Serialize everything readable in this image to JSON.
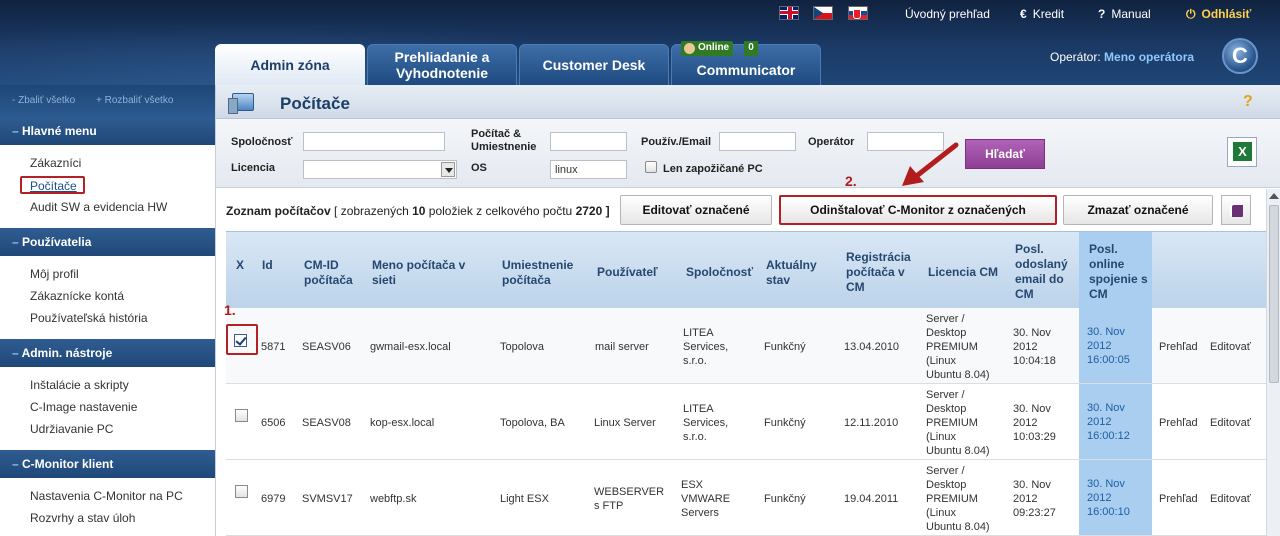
{
  "header": {
    "languages": [
      "en-flag-icon",
      "cz-flag-icon",
      "sk-flag-icon"
    ],
    "links": {
      "overview": "Úvodný prehľad",
      "credit": "Kredit",
      "manual": "Manual",
      "logout": "Odhlásiť"
    },
    "tabs": {
      "admin": "Admin zóna",
      "review": "Prehliadanie a Vyhodnotenie",
      "desk": "Customer Desk",
      "communicator": "Communicator"
    },
    "online_badge": "Online",
    "online_count": "0",
    "operator_label": "Operátor:",
    "operator_name": "Meno operátora",
    "logo_letter": "C"
  },
  "sidebar": {
    "collapse_all": "- Zbaliť všetko",
    "expand_all": "+ Rozbaliť všetko",
    "sections": [
      {
        "title": "Hlavné menu",
        "items": [
          "Zákazníci",
          "Počítače",
          "Audit SW a evidencia HW"
        ]
      },
      {
        "title": "Používatelia",
        "items": [
          "Môj profil",
          "Zákaznícke kontá",
          "Používateľská história"
        ]
      },
      {
        "title": "Admin. nástroje",
        "items": [
          "Inštalácie a skripty",
          "C-Image nastavenie",
          "Udržiavanie PC"
        ]
      },
      {
        "title": "C-Monitor klient",
        "items": [
          "Nastavenia C-Monitor na PC",
          "Rozvrhy a stav úloh"
        ]
      }
    ]
  },
  "page": {
    "title": "Počítače",
    "help": "?"
  },
  "filters": {
    "company_label": "Spoločnosť",
    "pc_location_label": "Počítač & Umiestnenie",
    "user_email_label": "Použív./Email",
    "operator_label": "Operátor",
    "license_label": "Licencia",
    "os_label": "OS",
    "os_value": "linux",
    "borrowed_label": "Len zapožičané PC",
    "search_button": "Hľadať"
  },
  "list": {
    "summary_prefix": "Zoznam počítačov",
    "summary_mid1": "[ zobrazených",
    "shown": "10",
    "summary_mid2": "položiek z celkového počtu",
    "total": "2720",
    "summary_end": "]",
    "edit_button": "Editovať označené",
    "uninstall_button": "Odinštalovať C-Monitor z označených",
    "delete_button": "Zmazať označené"
  },
  "annotations": {
    "step1": "1.",
    "step2": "2."
  },
  "table": {
    "headers": {
      "x": "X",
      "id": "Id",
      "cmid": "CM-ID počítača",
      "name": "Meno počítača v sieti",
      "location": "Umiestnenie počítača",
      "user": "Používateľ",
      "company": "Spoločnosť",
      "state": "Aktuálny stav",
      "registration": "Registrácia počítača v CM",
      "license": "Licencia CM",
      "last_email": "Posl. odoslaný email do CM",
      "last_online": "Posl. online spojenie s CM"
    },
    "rows": [
      {
        "checked": true,
        "id": "5871",
        "cmid": "SEASV06",
        "name": "gwmail-esx.local",
        "location": "Topolova",
        "user": "mail server",
        "company": "LITEA Services, s.r.o.",
        "state": "Funkčný",
        "registration": "13.04.2010",
        "license": "Server / Desktop PREMIUM (Linux Ubuntu 8.04)",
        "last_email": "30. Nov 2012 10:04:18",
        "last_online": "30. Nov 2012 16:00:05",
        "view": "Prehľad",
        "edit": "Editovať"
      },
      {
        "checked": false,
        "id": "6506",
        "cmid": "SEASV08",
        "name": "kop-esx.local",
        "location": "Topolova, BA",
        "user": "Linux Server",
        "company": "LITEA Services, s.r.o.",
        "state": "Funkčný",
        "registration": "12.11.2010",
        "license": "Server / Desktop PREMIUM (Linux Ubuntu 8.04)",
        "last_email": "30. Nov 2012 10:03:29",
        "last_online": "30. Nov 2012 16:00:12",
        "view": "Prehľad",
        "edit": "Editovať"
      },
      {
        "checked": false,
        "id": "6979",
        "cmid": "SVMSV17",
        "name": "webftp.sk",
        "location": "Light ESX",
        "user": "WEBSERVER s FTP",
        "company": "ESX VMWARE Servers",
        "state": "Funkčný",
        "registration": "19.04.2011",
        "license": "Server / Desktop PREMIUM (Linux Ubuntu 8.04)",
        "last_email": "30. Nov 2012 09:23:27",
        "last_online": "30. Nov 2012 16:00:10",
        "view": "Prehľad",
        "edit": "Editovať"
      }
    ]
  },
  "colors": {
    "accent": "#b32126",
    "search_button": "#9c4ca3",
    "online_cell": "#a9cef0"
  }
}
